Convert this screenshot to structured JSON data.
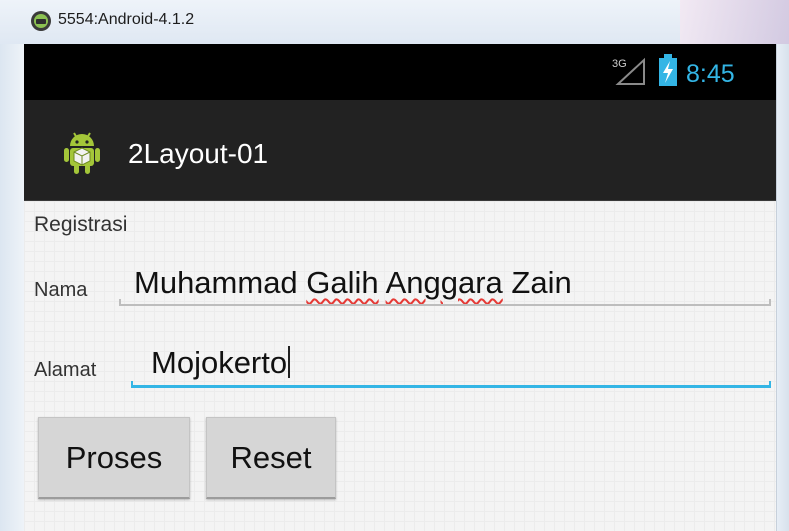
{
  "window": {
    "title": "5554:Android-4.1.2",
    "icon": "android-emulator-icon"
  },
  "statusbar": {
    "network": "3G",
    "time": "8:45",
    "accent": "#33b5e5"
  },
  "actionbar": {
    "app_title": "2Layout-01",
    "icon": "android-app-icon"
  },
  "form": {
    "heading": "Registrasi",
    "nama": {
      "label": "Nama",
      "value_parts": [
        "Muhammad ",
        "Galih",
        " ",
        "Anggara",
        " Zain"
      ]
    },
    "alamat": {
      "label": "Alamat",
      "value": "Mojokerto",
      "focused": true
    },
    "buttons": {
      "proses": "Proses",
      "reset": "Reset"
    }
  }
}
